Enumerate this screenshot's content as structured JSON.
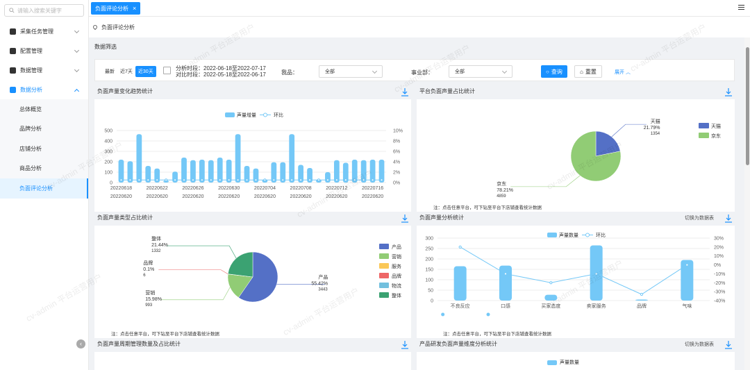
{
  "sidebar": {
    "search_placeholder": "请输入搜索关键字",
    "menus": [
      {
        "label": "采集任务管理"
      },
      {
        "label": "配置管理"
      },
      {
        "label": "数据管理"
      },
      {
        "label": "数据分析"
      }
    ],
    "sub_items": [
      {
        "label": "总体概览"
      },
      {
        "label": "品牌分析"
      },
      {
        "label": "店铺分析"
      },
      {
        "label": "商品分析"
      },
      {
        "label": "负面评论分析"
      }
    ]
  },
  "tabs": [
    {
      "label": "负面评论分析",
      "close": "×"
    }
  ],
  "breadcrumb": "负面评论分析",
  "filter": {
    "section_title": "数据筛选",
    "ranges": [
      "最新",
      "近7天",
      "近30天"
    ],
    "analysis_period": "分析时段：2022-06-18至2022-07-17",
    "compare_period": "对比时段：2022-05-18至2022-06-17",
    "product_label": "我品：",
    "product_value": "全部",
    "dept_label": "事业部：",
    "dept_value": "全部",
    "query_button": "查询",
    "reset_button": "重置",
    "expand": "展开"
  },
  "watermark": "cv-admin 平台运营用户",
  "panels": {
    "trend": {
      "title": "负面声量变化趋势统计",
      "legend_bar": "声量增量",
      "legend_line": "环比"
    },
    "platform": {
      "title": "平台负面声量占比统计",
      "note": "注：点击任意平台，可下钻至平台下店铺查看统计数据"
    },
    "type": {
      "title": "负面声量类型占比统计",
      "note": "注：点击任意平台，可下钻至平台下店铺查看统计数据"
    },
    "analysis": {
      "title": "负面声量分析统计",
      "switch": "切换为数据表",
      "legend_bar": "声量数量",
      "legend_line": "环比",
      "note": "注：点击任意平台，可下钻至平台下店铺查看统计数据"
    },
    "cycle": {
      "title": "负面声量周期管理数量及占比统计"
    },
    "rd": {
      "title": "产品研发负面声量维度分析统计",
      "switch": "切换为数据表",
      "legend_bar": "声量数量"
    }
  },
  "chart_data": [
    {
      "type": "bar",
      "title": "",
      "x_ticks_top": [
        "20220618",
        "20220622",
        "20220626",
        "20220630",
        "20220704",
        "20220708",
        "20220712",
        "20220716"
      ],
      "x_ticks_bottom": [
        "20220620",
        "20220620",
        "20220620",
        "20220620",
        "20220620",
        "20220620",
        "20220620",
        "20220620"
      ],
      "y_ticks": [
        "500",
        "400",
        "300",
        "200",
        "100",
        "0"
      ],
      "y2_ticks": [
        "10%",
        "8%",
        "6%",
        "4%",
        "2%",
        "0%"
      ],
      "ylim": [
        0,
        500
      ],
      "y2lim": [
        0,
        10
      ],
      "series": [
        {
          "name": "声量增量",
          "values": [
            220,
            205,
            465,
            160,
            135,
            20,
            105,
            240,
            215,
            220,
            215,
            240,
            220,
            465,
            160,
            135,
            30,
            195,
            195,
            465,
            170,
            140,
            30,
            100,
            215,
            190,
            220,
            215,
            220,
            220
          ]
        },
        {
          "name": "环比",
          "values": [
            0.5,
            0.5,
            0.5,
            0.5,
            0.5,
            0.5,
            0.5,
            0.5,
            0.5,
            0.5,
            0.5,
            0.5,
            0.5,
            0.5,
            0.5,
            0.5,
            0.5,
            0.5,
            0.5,
            0.5,
            0.5,
            0.5,
            0.5,
            0.5,
            0.5,
            0.5,
            0.5,
            0.5,
            0.5,
            0.5
          ]
        }
      ]
    },
    {
      "type": "pie",
      "title": "",
      "slices": [
        {
          "name": "天猫",
          "value": 1354,
          "percent": "21.79%",
          "color": "#5470c6"
        },
        {
          "name": "京东",
          "value": 4859,
          "percent": "78.21%",
          "color": "#91cc75"
        }
      ]
    },
    {
      "type": "pie",
      "title": "",
      "slices": [
        {
          "name": "产品",
          "value": 3443,
          "percent": "55.42%",
          "color": "#5470c6"
        },
        {
          "name": "营销",
          "value": 993,
          "percent": "15.98%",
          "color": "#91cc75"
        },
        {
          "name": "服务",
          "value": 0,
          "percent": "",
          "color": "#fac858"
        },
        {
          "name": "品牌",
          "value": 6,
          "percent": "0.1%",
          "color": "#ee6666"
        },
        {
          "name": "物流",
          "value": 0,
          "percent": "",
          "color": "#73c0de"
        },
        {
          "name": "整体",
          "value": 1332,
          "percent": "21.44%",
          "color": "#3ba272"
        }
      ]
    },
    {
      "type": "bar",
      "title": "",
      "categories": [
        "不良反应",
        "口感",
        "买家态度",
        "卖家服务",
        "品牌",
        "气味"
      ],
      "y_ticks": [
        "300",
        "250",
        "200",
        "150",
        "100",
        "50",
        "0"
      ],
      "y2_ticks": [
        "30%",
        "20%",
        "10%",
        "0%",
        "-10%",
        "-20%",
        "-30%",
        "-40%"
      ],
      "ylim": [
        0,
        300
      ],
      "y2lim": [
        -40,
        30
      ],
      "series": [
        {
          "name": "声量数量",
          "values": [
            165,
            168,
            28,
            265,
            5,
            195
          ]
        },
        {
          "name": "环比",
          "values": [
            20,
            -10,
            -20,
            -10,
            -33,
            0
          ]
        }
      ]
    }
  ]
}
